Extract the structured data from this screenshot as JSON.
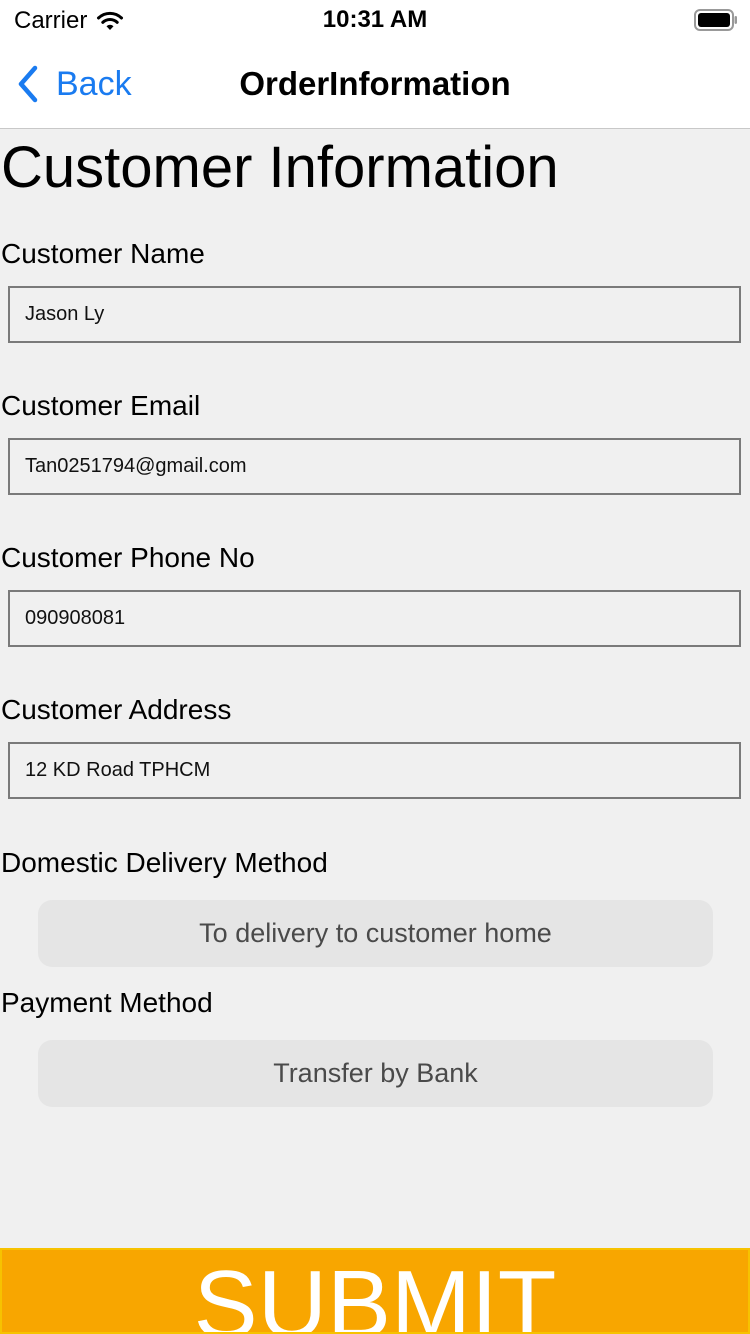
{
  "status_bar": {
    "carrier": "Carrier",
    "time": "10:31 AM"
  },
  "nav": {
    "back_label": "Back",
    "title": "OrderInformation",
    "accent_color": "#1a7bf0"
  },
  "form": {
    "section_title": "Customer Information",
    "name": {
      "label": "Customer Name",
      "value": "Jason Ly"
    },
    "email": {
      "label": "Customer Email",
      "value": "Tan0251794@gmail.com"
    },
    "phone": {
      "label": "Customer Phone No",
      "value": "090908081"
    },
    "address": {
      "label": "Customer Address",
      "value": "12 KD Road TPHCM"
    },
    "delivery": {
      "label": "Domestic Delivery Method",
      "selected": "To delivery to customer home"
    },
    "payment": {
      "label": "Payment Method",
      "selected": "Transfer by Bank"
    }
  },
  "submit": {
    "label": "SUBMIT",
    "color": "#f8a600"
  }
}
